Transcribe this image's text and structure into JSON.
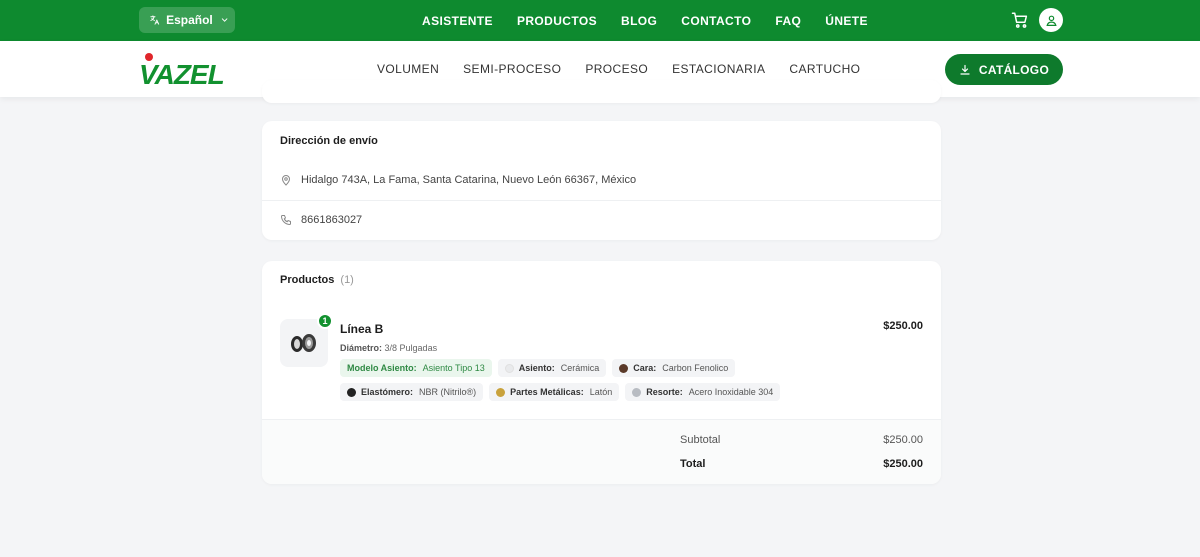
{
  "topbar": {
    "language": "Español",
    "nav": [
      "ASISTENTE",
      "PRODUCTOS",
      "BLOG",
      "CONTACTO",
      "FAQ",
      "ÚNETE"
    ]
  },
  "header": {
    "logo_text": "VAZEL",
    "nav": [
      "VOLUMEN",
      "SEMI-PROCESO",
      "PROCESO",
      "ESTACIONARIA",
      "CARTUCHO"
    ],
    "catalog_label": "CATÁLOGO"
  },
  "shipping": {
    "title": "Dirección de envío",
    "address": "Hidalgo 743A, La Fama, Santa Catarina, Nuevo León 66367, México",
    "phone": "8661863027"
  },
  "products": {
    "title": "Productos",
    "count": "(1)",
    "item": {
      "quantity": "1",
      "name": "Línea B",
      "price": "$250.00",
      "diameter_label": "Diámetro:",
      "diameter_value": "3/8 Pulgadas",
      "attributes_row1": [
        {
          "label": "Modelo Asiento:",
          "value": "Asiento Tipo 13",
          "color": "",
          "style": "green"
        },
        {
          "label": "Asiento:",
          "value": "Cerámica",
          "color": "#e9eaec",
          "style": "gray"
        },
        {
          "label": "Cara:",
          "value": "Carbon Fenolico",
          "color": "#5b3a29",
          "style": "gray"
        }
      ],
      "attributes_row2": [
        {
          "label": "Elastómero:",
          "value": "NBR (Nitrilo®)",
          "color": "#222222",
          "style": "gray"
        },
        {
          "label": "Partes Metálicas:",
          "value": "Latón",
          "color": "#c9a23c",
          "style": "gray"
        },
        {
          "label": "Resorte:",
          "value": "Acero Inoxidable 304",
          "color": "#b8bcc2",
          "style": "gray"
        }
      ]
    },
    "subtotal_label": "Subtotal",
    "subtotal_value": "$250.00",
    "total_label": "Total",
    "total_value": "$250.00"
  },
  "colors": {
    "brand_green": "#0e8a2f",
    "logo_red": "#e0262b"
  }
}
